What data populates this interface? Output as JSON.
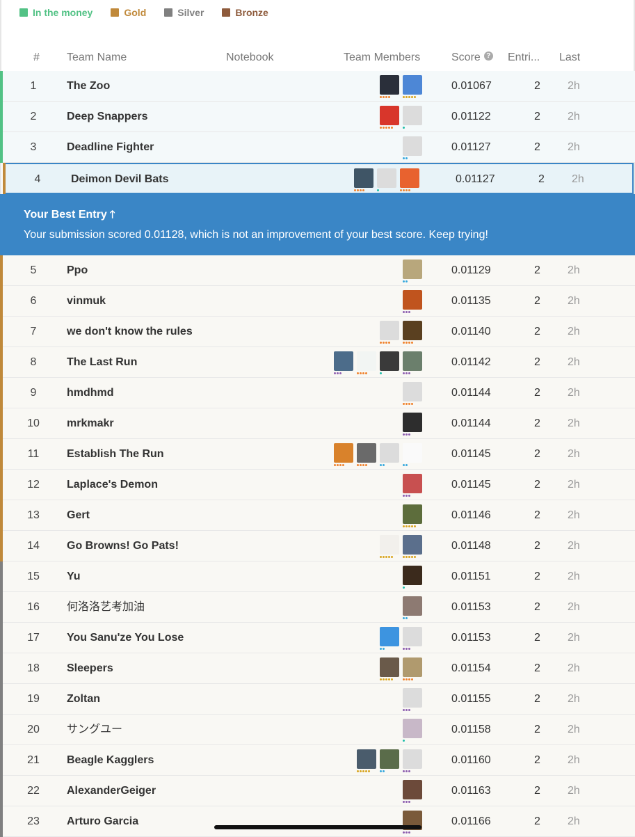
{
  "colors": {
    "money": "#52c285",
    "gold": "#c0893a",
    "silver": "#808080",
    "bronze": "#8e5b3c",
    "banner": "#3a86c6",
    "dot_orange": "#f0822d",
    "dot_gold": "#d9a521",
    "dot_blue": "#38a9de",
    "dot_purple": "#8e5fb0",
    "dot_teal": "#20beaa"
  },
  "legend": [
    {
      "label": "In the money",
      "color": "#52c285"
    },
    {
      "label": "Gold",
      "color": "#c0893a"
    },
    {
      "label": "Silver",
      "color": "#808080"
    },
    {
      "label": "Bronze",
      "color": "#8e5b3c"
    }
  ],
  "header": {
    "rank": "#",
    "team": "Team Name",
    "notebook": "Notebook",
    "members": "Team Members",
    "score": "Score",
    "entries": "Entri...",
    "last": "Last"
  },
  "banner": {
    "title": "Your Best Entry",
    "message": "Your submission scored 0.01128, which is not an improvement of your best score. Keep trying!"
  },
  "rows_top": [
    {
      "rank": "1",
      "team": "The Zoo",
      "score": "0.01067",
      "entries": "2",
      "last": "2h",
      "tier": "money",
      "members": [
        {
          "color": "#2a2f3a",
          "dots": "orange4"
        },
        {
          "color": "#4d87d6",
          "dots": "gold5"
        }
      ]
    },
    {
      "rank": "2",
      "team": "Deep Snappers",
      "score": "0.01122",
      "entries": "2",
      "last": "2h",
      "tier": "money",
      "members": [
        {
          "color": "#d8362b",
          "dots": "orange5"
        },
        {
          "color": "#dcdcdc",
          "dots": "teal1"
        }
      ]
    },
    {
      "rank": "3",
      "team": "Deadline Fighter",
      "score": "0.01127",
      "entries": "2",
      "last": "2h",
      "tier": "money",
      "members": [
        {
          "color": "#dcdcdc",
          "dots": "blue2"
        }
      ]
    },
    {
      "rank": "4",
      "team": "Deimon Devil Bats",
      "score": "0.01127",
      "entries": "2",
      "last": "2h",
      "tier": "highlight",
      "members": [
        {
          "color": "#3f5566",
          "dots": "orange4"
        },
        {
          "color": "#dcdcdc",
          "dots": "teal1"
        },
        {
          "color": "#e8622f",
          "dots": "orange4"
        }
      ]
    }
  ],
  "rows_bottom": [
    {
      "rank": "5",
      "team": "Ppo",
      "score": "0.01129",
      "entries": "2",
      "last": "2h",
      "tier": "gold",
      "members": [
        {
          "color": "#b8a77c",
          "dots": "blue2"
        }
      ]
    },
    {
      "rank": "6",
      "team": "vinmuk",
      "score": "0.01135",
      "entries": "2",
      "last": "2h",
      "tier": "gold",
      "members": [
        {
          "color": "#c0541e",
          "dots": "purple3"
        }
      ]
    },
    {
      "rank": "7",
      "team": "we don't know the rules",
      "score": "0.01140",
      "entries": "2",
      "last": "2h",
      "tier": "gold",
      "members": [
        {
          "color": "#dcdcdc",
          "dots": "orange4"
        },
        {
          "color": "#5a4020",
          "dots": "orange4"
        }
      ]
    },
    {
      "rank": "8",
      "team": "The Last Run",
      "score": "0.01142",
      "entries": "2",
      "last": "2h",
      "tier": "gold",
      "members": [
        {
          "color": "#4c6c8a",
          "dots": "purple3"
        },
        {
          "color": "#f2f5f3",
          "dots": "orange4"
        },
        {
          "color": "#3a3a3a",
          "dots": "teal1"
        },
        {
          "color": "#6b7f6c",
          "dots": "purple3"
        }
      ]
    },
    {
      "rank": "9",
      "team": "hmdhmd",
      "score": "0.01144",
      "entries": "2",
      "last": "2h",
      "tier": "gold",
      "members": [
        {
          "color": "#dcdcdc",
          "dots": "orange4"
        }
      ]
    },
    {
      "rank": "10",
      "team": "mrkmakr",
      "score": "0.01144",
      "entries": "2",
      "last": "2h",
      "tier": "gold",
      "members": [
        {
          "color": "#2d2d2d",
          "dots": "purple3"
        }
      ]
    },
    {
      "rank": "11",
      "team": "Establish The Run",
      "score": "0.01145",
      "entries": "2",
      "last": "2h",
      "tier": "gold",
      "members": [
        {
          "color": "#d9822b",
          "dots": "orange4"
        },
        {
          "color": "#6a6a6a",
          "dots": "orange4"
        },
        {
          "color": "#dcdcdc",
          "dots": "blue2"
        },
        {
          "color": "#fafafa",
          "dots": "blue2"
        }
      ]
    },
    {
      "rank": "12",
      "team": "Laplace's Demon",
      "score": "0.01145",
      "entries": "2",
      "last": "2h",
      "tier": "gold",
      "members": [
        {
          "color": "#c85050",
          "dots": "purple3"
        }
      ]
    },
    {
      "rank": "13",
      "team": "Gert",
      "score": "0.01146",
      "entries": "2",
      "last": "2h",
      "tier": "gold",
      "members": [
        {
          "color": "#5d6d3c",
          "dots": "gold5"
        }
      ]
    },
    {
      "rank": "14",
      "team": "Go Browns! Go Pats!",
      "score": "0.01148",
      "entries": "2",
      "last": "2h",
      "tier": "gold",
      "members": [
        {
          "color": "#f2f0ec",
          "dots": "gold5"
        },
        {
          "color": "#5b6f8c",
          "dots": "gold5"
        }
      ]
    },
    {
      "rank": "15",
      "team": "Yu",
      "score": "0.01151",
      "entries": "2",
      "last": "2h",
      "tier": "silver",
      "members": [
        {
          "color": "#3b2a1c",
          "dots": "teal1"
        }
      ]
    },
    {
      "rank": "16",
      "team": "何洛洛艺考加油",
      "score": "0.01153",
      "entries": "2",
      "last": "2h",
      "tier": "silver",
      "cjk": true,
      "members": [
        {
          "color": "#8d7a72",
          "dots": "blue2"
        }
      ]
    },
    {
      "rank": "17",
      "team": "You Sanu'ze You Lose",
      "score": "0.01153",
      "entries": "2",
      "last": "2h",
      "tier": "silver",
      "members": [
        {
          "color": "#3d94e0",
          "dots": "blue2"
        },
        {
          "color": "#dcdcdc",
          "dots": "purple3"
        }
      ]
    },
    {
      "rank": "18",
      "team": "Sleepers",
      "score": "0.01154",
      "entries": "2",
      "last": "2h",
      "tier": "silver",
      "members": [
        {
          "color": "#6a5a4a",
          "dots": "gold5"
        },
        {
          "color": "#b09a6e",
          "dots": "orange4"
        }
      ]
    },
    {
      "rank": "19",
      "team": "Zoltan",
      "score": "0.01155",
      "entries": "2",
      "last": "2h",
      "tier": "silver",
      "members": [
        {
          "color": "#dcdcdc",
          "dots": "purple3"
        }
      ]
    },
    {
      "rank": "20",
      "team": "サングユー",
      "score": "0.01158",
      "entries": "2",
      "last": "2h",
      "tier": "silver",
      "cjk": true,
      "members": [
        {
          "color": "#c8b8c8",
          "dots": "teal1"
        }
      ]
    },
    {
      "rank": "21",
      "team": "Beagle Kagglers",
      "score": "0.01160",
      "entries": "2",
      "last": "2h",
      "tier": "silver",
      "members": [
        {
          "color": "#4a5c6c",
          "dots": "gold5"
        },
        {
          "color": "#5a6c4a",
          "dots": "blue2"
        },
        {
          "color": "#dcdcdc",
          "dots": "purple3"
        }
      ]
    },
    {
      "rank": "22",
      "team": "AlexanderGeiger",
      "score": "0.01163",
      "entries": "2",
      "last": "2h",
      "tier": "silver",
      "members": [
        {
          "color": "#6c4a3a",
          "dots": "purple3"
        }
      ]
    },
    {
      "rank": "23",
      "team": "Arturo Garcia",
      "score": "0.01166",
      "entries": "2",
      "last": "2h",
      "tier": "silver",
      "members": [
        {
          "color": "#7a5a3a",
          "dots": "purple3"
        }
      ]
    }
  ]
}
